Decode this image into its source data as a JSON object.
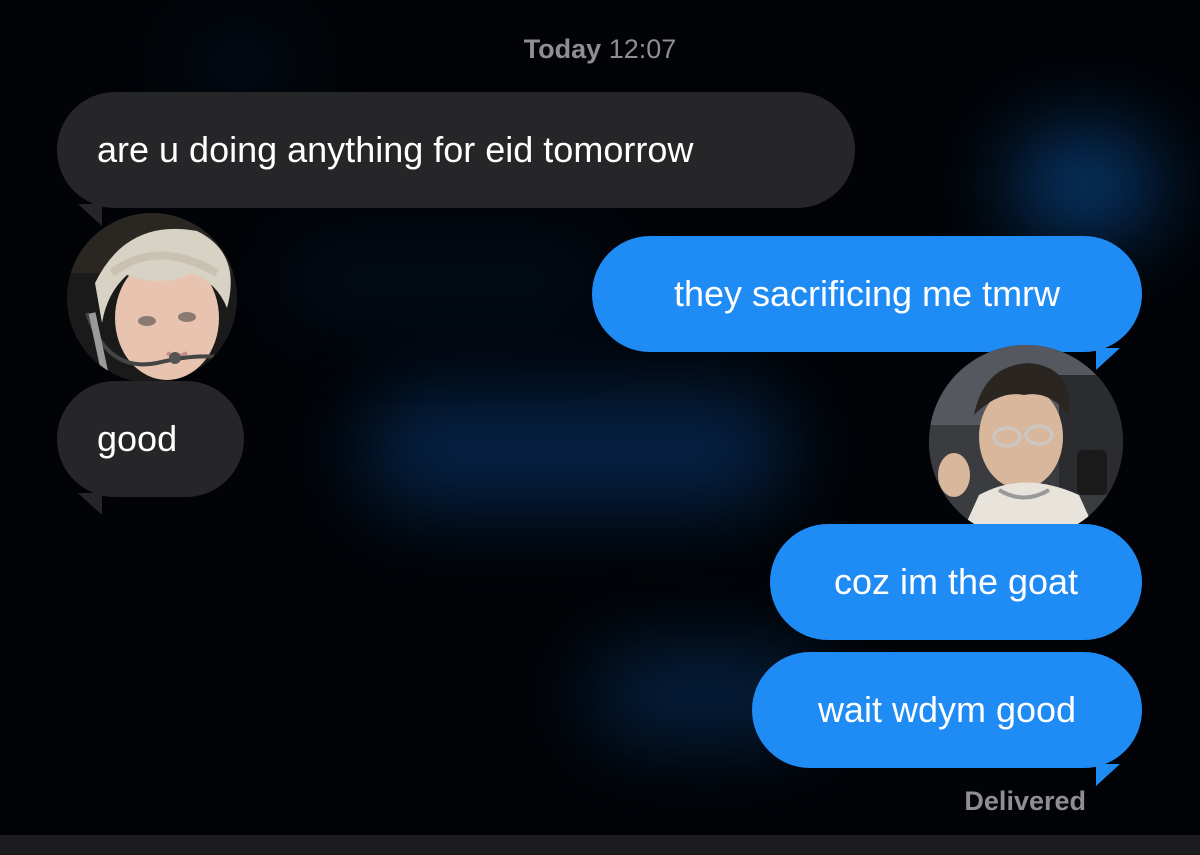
{
  "header": {
    "day": "Today",
    "time": "12:07"
  },
  "messages": [
    {
      "sender": "them",
      "text": "are u doing anything for eid tomorrow"
    },
    {
      "sender": "me",
      "text": "they sacrificing me tmrw"
    },
    {
      "sender": "them",
      "text": "good"
    },
    {
      "sender": "me",
      "text": "coz im the goat"
    },
    {
      "sender": "me",
      "text": "wait wdym good"
    }
  ],
  "status": {
    "delivered": "Delivered"
  },
  "colors": {
    "incoming_bubble": "#262628",
    "outgoing_bubble": "#1f8bf5",
    "background": "#000000",
    "meta_text": "#8e8e93"
  },
  "avatars": {
    "them": "contact-avatar-photo",
    "me": "user-avatar-photo"
  }
}
